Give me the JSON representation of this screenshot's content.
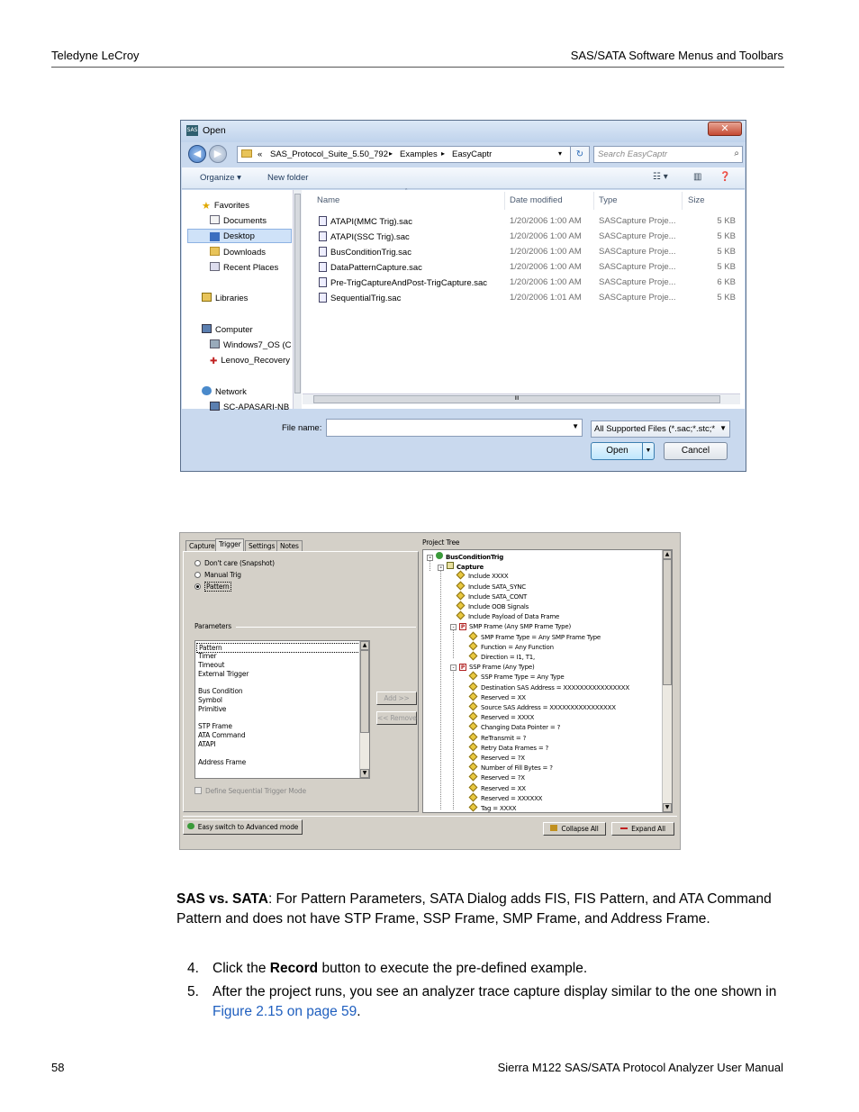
{
  "header": {
    "left": "Teledyne LeCroy",
    "right": "SAS/SATA Software Menus and Toolbars"
  },
  "footer": {
    "page": "58",
    "title": "Sierra M122 SAS/SATA Protocol Analyzer User Manual"
  },
  "open_dialog": {
    "app_icon_text": "SAS",
    "title": "Open",
    "close": "✕",
    "address": {
      "overflow": "«",
      "segments": [
        "SAS_Protocol_Suite_5.50_792",
        "Examples",
        "EasyCaptr"
      ]
    },
    "search_placeholder": "Search EasyCaptr",
    "toolbar": {
      "organize": "Organize ▾",
      "new_folder": "New folder"
    },
    "nav": {
      "favorites": "Favorites",
      "documents": "Documents",
      "desktop": "Desktop",
      "downloads": "Downloads",
      "recent_places": "Recent Places",
      "libraries": "Libraries",
      "computer": "Computer",
      "drive_c": "Windows7_OS (C",
      "drive_recovery": "Lenovo_Recovery",
      "network": "Network",
      "network_pc": "SC-APASARI-NB"
    },
    "columns": {
      "name": "Name",
      "date": "Date modified",
      "type": "Type",
      "size": "Size"
    },
    "files": [
      {
        "name": "ATAPI(MMC Trig).sac",
        "date": "1/20/2006 1:00 AM",
        "type": "SASCapture Proje...",
        "size": "5 KB"
      },
      {
        "name": "ATAPI(SSC Trig).sac",
        "date": "1/20/2006 1:00 AM",
        "type": "SASCapture Proje...",
        "size": "5 KB"
      },
      {
        "name": "BusConditionTrig.sac",
        "date": "1/20/2006 1:00 AM",
        "type": "SASCapture Proje...",
        "size": "5 KB"
      },
      {
        "name": "DataPatternCapture.sac",
        "date": "1/20/2006 1:00 AM",
        "type": "SASCapture Proje...",
        "size": "5 KB"
      },
      {
        "name": "Pre-TrigCaptureAndPost-TrigCapture.sac",
        "date": "1/20/2006 1:00 AM",
        "type": "SASCapture Proje...",
        "size": "6 KB"
      },
      {
        "name": "SequentialTrig.sac",
        "date": "1/20/2006 1:01 AM",
        "type": "SASCapture Proje...",
        "size": "5 KB"
      }
    ],
    "scroll_grip": "III",
    "file_name_label": "File name:",
    "file_name_value": "",
    "file_type": "All Supported Files (*.sac;*.stc;*",
    "open_button": "Open",
    "cancel_button": "Cancel"
  },
  "project_dialog": {
    "tabs": [
      "Capture",
      "Trigger",
      "Settings",
      "Notes"
    ],
    "radios": [
      {
        "label": "Don't care (Snapshot)",
        "checked": false
      },
      {
        "label": "Manual Trig",
        "checked": false
      },
      {
        "label": "Pattern",
        "checked": true
      }
    ],
    "parameters_label": "Parameters",
    "parameters": [
      {
        "label": "Pattern",
        "gap": false
      },
      {
        "label": "Timer",
        "gap": false
      },
      {
        "label": "Timeout",
        "gap": false
      },
      {
        "label": "External Trigger",
        "gap": false
      },
      {
        "label": "Bus Condition",
        "gap": true
      },
      {
        "label": "Symbol",
        "gap": false
      },
      {
        "label": "Primitive",
        "gap": false
      },
      {
        "label": "STP Frame",
        "gap": true
      },
      {
        "label": "ATA Command",
        "gap": false
      },
      {
        "label": "ATAPI",
        "gap": false
      },
      {
        "label": "Address Frame",
        "gap": true
      }
    ],
    "add_button": "Add >>",
    "remove_button": "<< Remove",
    "sequential_checkbox": "Define Sequential Trigger Mode",
    "tree_label": "Project Tree",
    "tree": [
      {
        "text": "BusConditionTrig",
        "level": 0,
        "icon": "green",
        "bold": true,
        "pm": "-"
      },
      {
        "text": "Capture",
        "level": 1,
        "icon": "folder",
        "bold": true,
        "pm": "-"
      },
      {
        "text": "Include XXXX",
        "level": 2,
        "icon": "pen"
      },
      {
        "text": "Include SATA_SYNC",
        "level": 2,
        "icon": "pen"
      },
      {
        "text": "Include SATA_CONT",
        "level": 2,
        "icon": "pen"
      },
      {
        "text": "Include OOB Signals",
        "level": 2,
        "icon": "pen"
      },
      {
        "text": "Include Payload of Data Frame",
        "level": 2,
        "icon": "pen"
      },
      {
        "text": "SMP Frame (Any SMP Frame Type)",
        "level": 2,
        "icon": "p",
        "pm": "-"
      },
      {
        "text": "SMP Frame Type = Any SMP Frame Type",
        "level": 3,
        "icon": "pen"
      },
      {
        "text": "Function = Any Function",
        "level": 3,
        "icon": "pen"
      },
      {
        "text": "Direction = I1, T1,",
        "level": 3,
        "icon": "pen"
      },
      {
        "text": "SSP Frame (Any Type)",
        "level": 2,
        "icon": "p",
        "pm": "-"
      },
      {
        "text": "SSP Frame Type = Any Type",
        "level": 3,
        "icon": "pen"
      },
      {
        "text": "Destination SAS Address = XXXXXXXXXXXXXXXX",
        "level": 3,
        "icon": "pen"
      },
      {
        "text": "Reserved = XX",
        "level": 3,
        "icon": "pen"
      },
      {
        "text": "Source SAS Address = XXXXXXXXXXXXXXXX",
        "level": 3,
        "icon": "pen"
      },
      {
        "text": "Reserved = XXXX",
        "level": 3,
        "icon": "pen"
      },
      {
        "text": "Changing Data Pointer = ?",
        "level": 3,
        "icon": "pen"
      },
      {
        "text": "ReTransmit = ?",
        "level": 3,
        "icon": "pen"
      },
      {
        "text": "Retry Data Frames = ?",
        "level": 3,
        "icon": "pen"
      },
      {
        "text": "Reserved = ?X",
        "level": 3,
        "icon": "pen"
      },
      {
        "text": "Number of Fill Bytes = ?",
        "level": 3,
        "icon": "pen"
      },
      {
        "text": "Reserved = ?X",
        "level": 3,
        "icon": "pen"
      },
      {
        "text": "Reserved = XX",
        "level": 3,
        "icon": "pen"
      },
      {
        "text": "Reserved = XXXXXX",
        "level": 3,
        "icon": "pen"
      },
      {
        "text": "Tag = XXXX",
        "level": 3,
        "icon": "pen"
      }
    ],
    "easy_button": "Easy switch to Advanced mode",
    "collapse_button": "Collapse All",
    "expand_button": "Expand All"
  },
  "body": {
    "note_bold": "SAS vs. SATA",
    "note_text": ": For Pattern Parameters, SATA Dialog adds FIS, FIS Pattern, and ATA Command Pattern and does not have STP Frame, SSP Frame, SMP Frame, and Address Frame.",
    "step4_num": "4.",
    "step4_pre": "Click the ",
    "step4_bold": "Record",
    "step4_post": " button to execute the pre-defined example.",
    "step5_num": "5.",
    "step5_pre": "After the project runs, you see an analyzer trace capture display similar to the one shown in ",
    "step5_link": "Figure 2.15 on page 59",
    "step5_post": "."
  }
}
